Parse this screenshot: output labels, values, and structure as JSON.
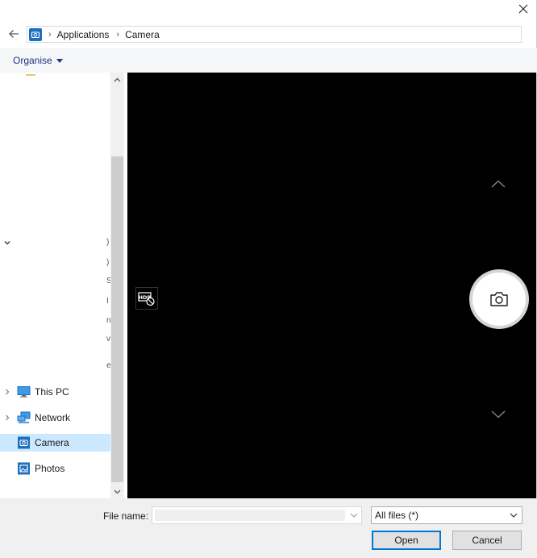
{
  "address": {
    "breadcrumbs": [
      "Applications",
      "Camera"
    ]
  },
  "toolbar": {
    "organise_label": "Organise"
  },
  "nav": {
    "clipped_marks": [
      ")",
      ")",
      "S",
      "I",
      "n",
      "v",
      "e"
    ],
    "items": [
      {
        "label": "This PC",
        "icon": "monitor-icon"
      },
      {
        "label": "Network",
        "icon": "network-icon"
      },
      {
        "label": "Camera",
        "icon": "camera-app-icon",
        "selected": true
      },
      {
        "label": "Photos",
        "icon": "photos-app-icon"
      }
    ]
  },
  "preview": {
    "hdr_text": "HDR"
  },
  "bottom": {
    "file_name_label": "File name:",
    "file_name_value": "",
    "filter_selected": "All files (*)",
    "open_label": "Open",
    "cancel_label": "Cancel"
  },
  "colors": {
    "accent": "#0078d7",
    "selection": "#cce8ff",
    "link": "#1e3287",
    "preview_bg": "#000000"
  }
}
